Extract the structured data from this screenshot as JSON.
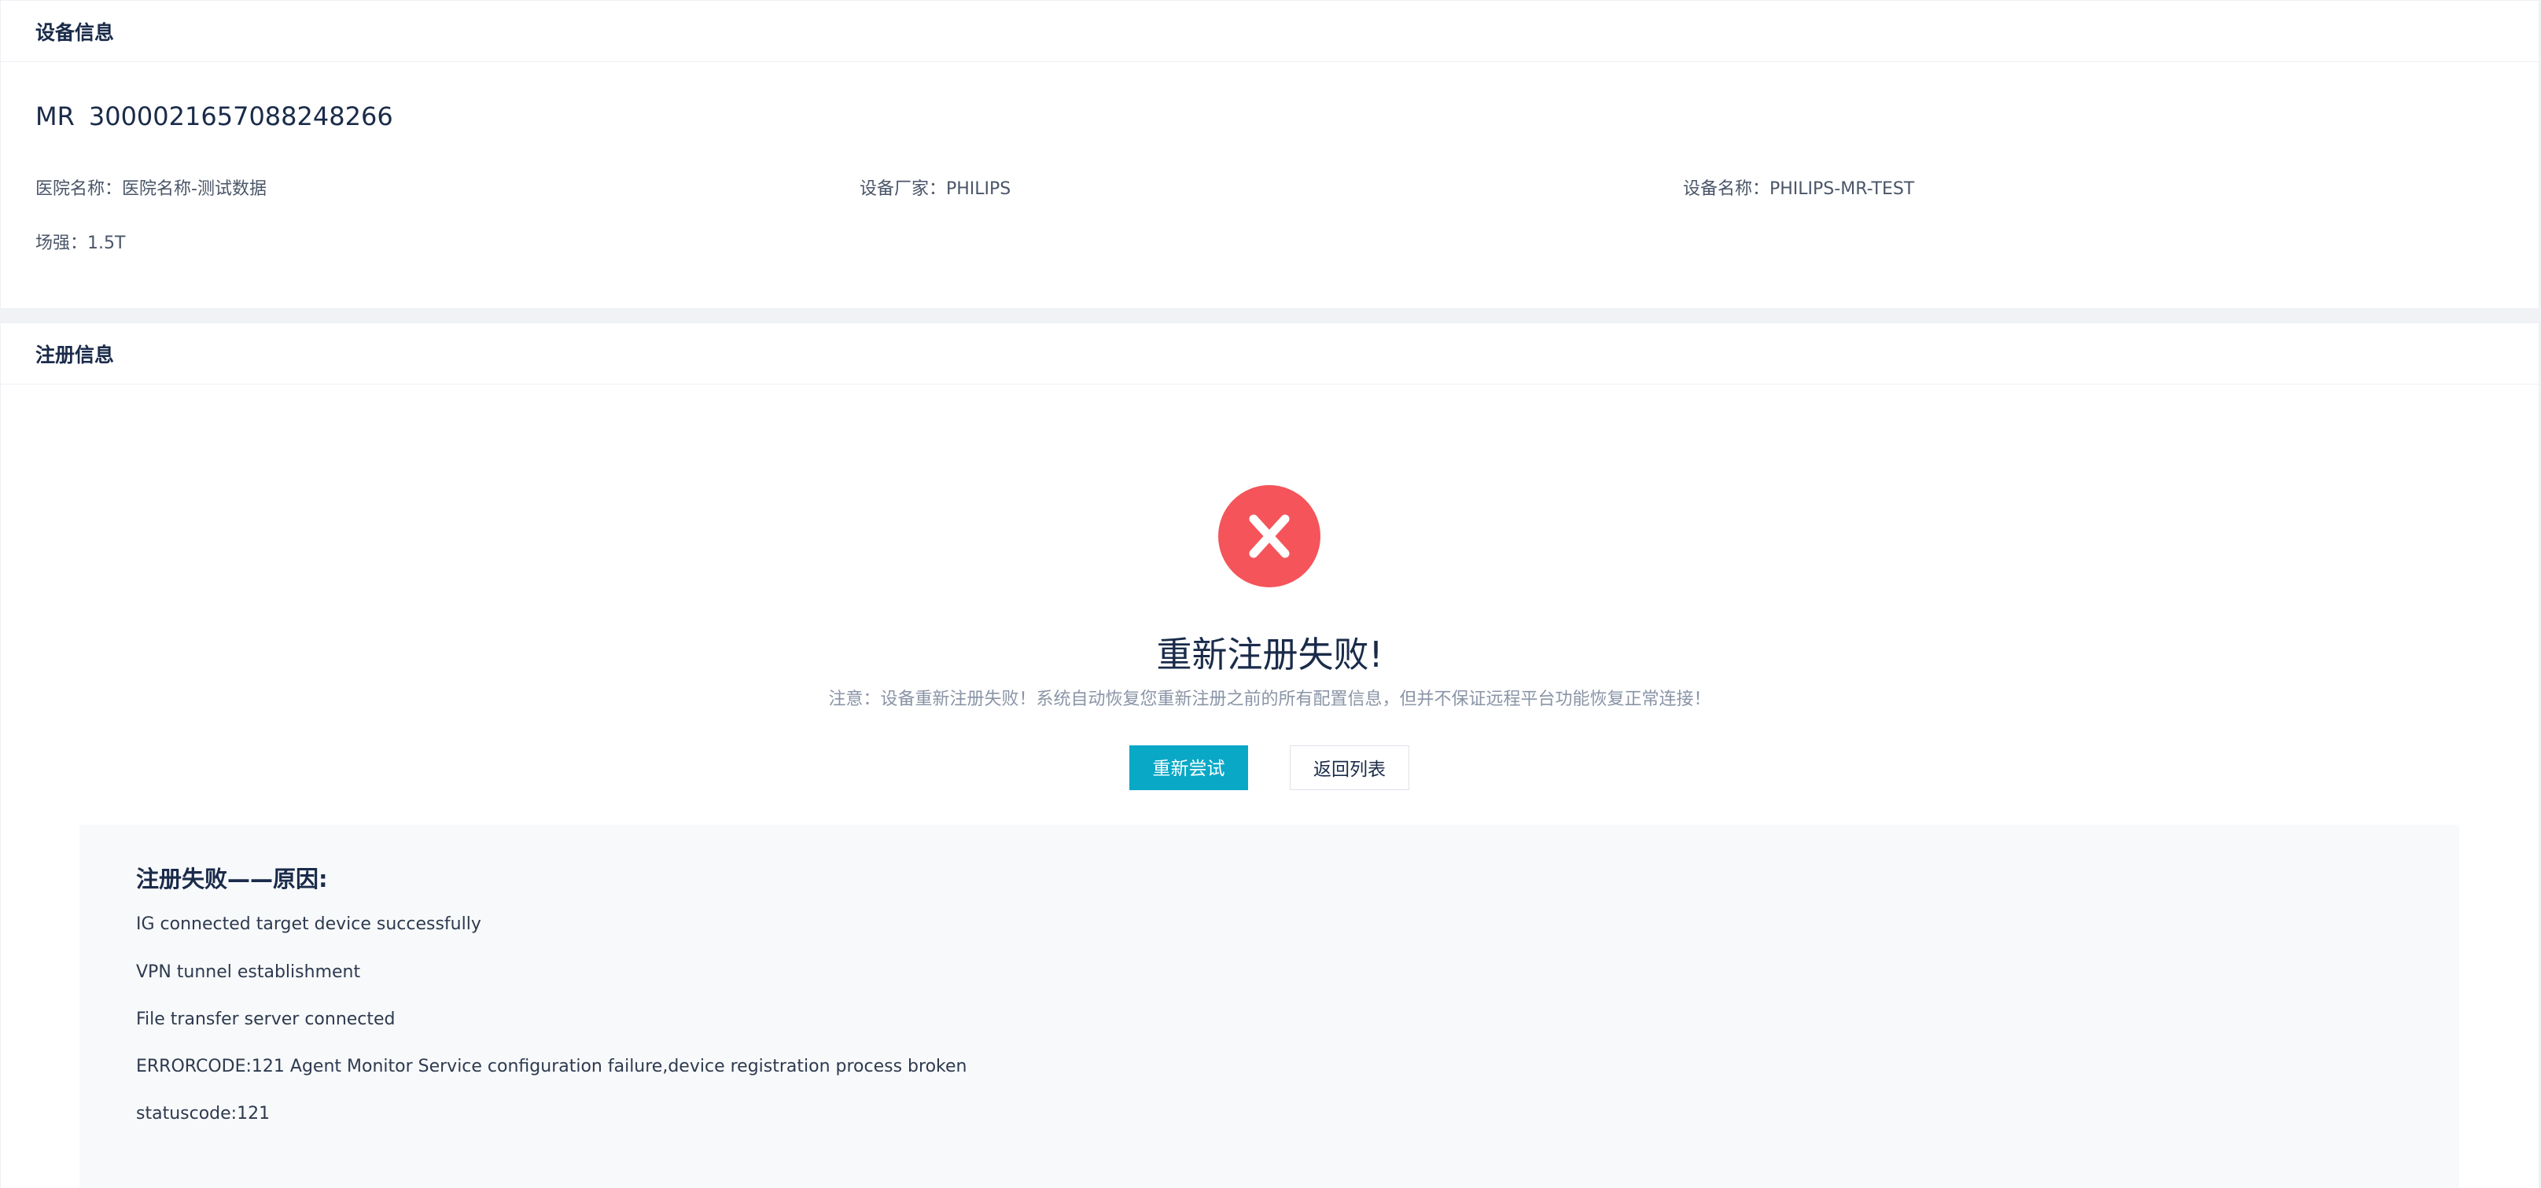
{
  "device_panel": {
    "title": "设备信息",
    "modality": "MR",
    "serial": "3000021657088248266",
    "hospital_name": "医院名称：医院名称-测试数据",
    "manufacturer": "设备厂家：PHILIPS",
    "device_name": "设备名称：PHILIPS-MR-TEST",
    "field_strength": "场强：1.5T"
  },
  "registration_panel": {
    "title": "注册信息",
    "status_icon": "close-icon",
    "status_color": "#f5545a",
    "result_title": "重新注册失败!",
    "result_note": "注意：设备重新注册失败！系统自动恢复您重新注册之前的所有配置信息，但并不保证远程平台功能恢复正常连接！",
    "retry_button": "重新尝试",
    "back_button": "返回列表",
    "accent_color": "#0aa8c7",
    "reason": {
      "title": "注册失败——原因:",
      "lines": [
        "IG connected target device successfully",
        "VPN tunnel establishment",
        "File transfer server connected",
        "ERRORCODE:121 Agent Monitor Service configuration failure,device registration process broken",
        "statuscode:121"
      ]
    }
  }
}
